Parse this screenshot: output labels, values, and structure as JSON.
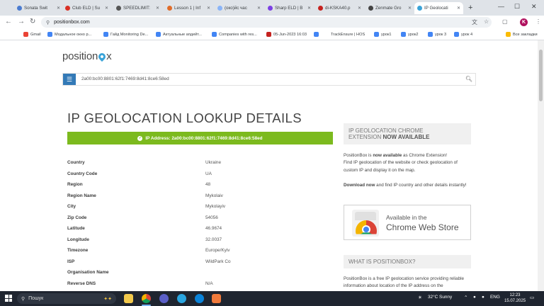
{
  "tabs": [
    {
      "title": "Sonata Swit",
      "color": "#4a7bd0"
    },
    {
      "title": "Club ELD | Su",
      "color": "#d93025"
    },
    {
      "title": "SPEEDLIMIT:",
      "color": "#555555"
    },
    {
      "title": "Lesson 1 | Inf",
      "color": "#e06c2a"
    },
    {
      "title": "(око)йс час",
      "color": "#8ab4f8"
    },
    {
      "title": "Sharp ELD | B",
      "color": "#7b3fe4"
    },
    {
      "title": "di-KSKA40.p",
      "color": "#c5221f"
    },
    {
      "title": "Zenmate Gro",
      "color": "#444444"
    },
    {
      "title": "IP Geolocati",
      "color": "#3aa3d8"
    }
  ],
  "toolbar": {
    "url": "positionbox.com",
    "avatar_letter": "K"
  },
  "bookmarks": [
    {
      "label": "Gmail",
      "color": "#ea4335"
    },
    {
      "label": "Модальное окно р...",
      "color": "#4285f4"
    },
    {
      "label": "Гайд Monitoring De...",
      "color": "#4285f4"
    },
    {
      "label": "Актуальные апдейт...",
      "color": "#4285f4"
    },
    {
      "label": "Companies with res...",
      "color": "#4285f4"
    },
    {
      "label": "05-Jun-2023 16:03",
      "color": "#c5221f"
    },
    {
      "label": "",
      "color": "#4285f4"
    },
    {
      "label": "TrackEnsure | HOS",
      "color": "#ffffff"
    },
    {
      "label": "урок1",
      "color": "#4285f4"
    },
    {
      "label": "урок2",
      "color": "#4285f4"
    },
    {
      "label": "урок 3",
      "color": "#4285f4"
    },
    {
      "label": "урок 4",
      "color": "#4285f4"
    },
    {
      "label": "Все закладки",
      "color": "#fbbc04"
    }
  ],
  "site": {
    "logo_pre": "position",
    "logo_post": "x",
    "search_value": "2a00:bc00:8801:62f1:7469:8d41:8ce6:58ed",
    "title": "IP GEOLOCATION LOOKUP DETAILS",
    "ip_bar": "IP Address: 2a00:bc00:8801:62f1:7469:8d41:8ce6:58ed"
  },
  "details": [
    {
      "label": "Country",
      "value": "Ukraine"
    },
    {
      "label": "Country Code",
      "value": "UA"
    },
    {
      "label": "Region",
      "value": "48"
    },
    {
      "label": "Region Name",
      "value": "Mykolaiv"
    },
    {
      "label": "City",
      "value": "Mykolayiv"
    },
    {
      "label": "Zip Code",
      "value": "54056"
    },
    {
      "label": "Latitude",
      "value": "46.9674"
    },
    {
      "label": "Longitude",
      "value": "32.0037"
    },
    {
      "label": "Timezone",
      "value": "Europe/Kyiv"
    },
    {
      "label": "ISP",
      "value": "WildPark Co"
    },
    {
      "label": "Organisation Name",
      "value": ""
    },
    {
      "label": "Reverse DNS",
      "value": "N/A"
    }
  ],
  "sidebar": {
    "ext_heading_1": "IP GEOLOCATION CHROME",
    "ext_heading_2": "EXTENSION ",
    "ext_heading_bold": "NOW AVAILABLE",
    "ext_p1_a": "PositionBox is ",
    "ext_p1_b": "now available",
    "ext_p1_c": " as Chrome Extension!",
    "ext_p1_d": "Find IP geolocation of the website or check geolocation of custom IP and display it on the map.",
    "ext_p2_a": "Download now",
    "ext_p2_b": " and find IP country and other details instantly!",
    "cws_line1": "Available in the",
    "cws_line2": "Chrome Web Store",
    "what_heading": "WHAT IS POSITIONBOX?",
    "what_p": "PositionBox is a free IP geolocation service providing reliable information about location of the IP address on the"
  },
  "taskbar": {
    "search_placeholder": "Пошук",
    "weather": "32°C  Sunny",
    "lang": "ENG",
    "time": "12:23",
    "date": "15.07.2025"
  }
}
